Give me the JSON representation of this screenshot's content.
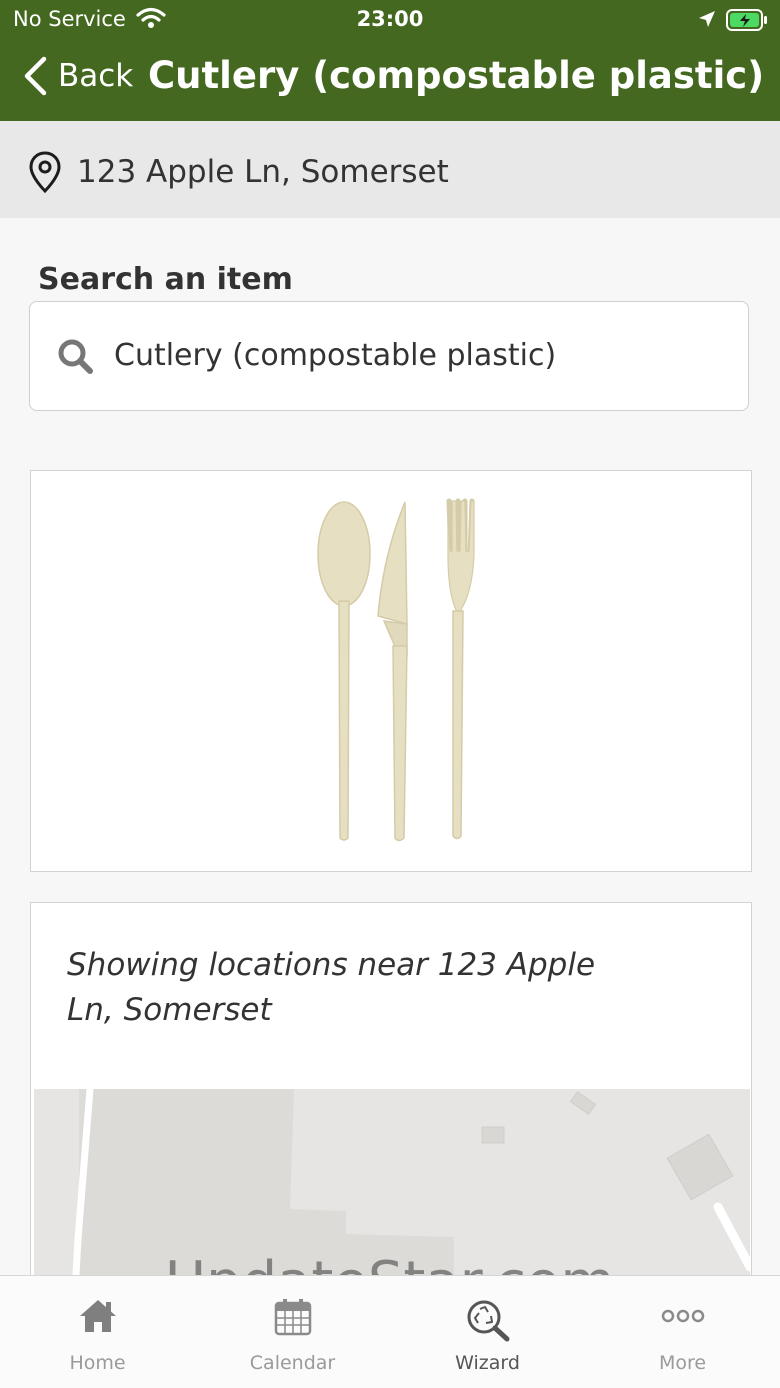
{
  "status_bar": {
    "carrier": "No Service",
    "time": "23:00"
  },
  "nav": {
    "back_label": "Back",
    "title": "Cutlery (compostable plastic)"
  },
  "location": {
    "address": "123 Apple Ln, Somerset"
  },
  "search": {
    "label": "Search an item",
    "value": "Cutlery (compostable plastic)"
  },
  "locations_card": {
    "showing_text": "Showing locations near 123 Apple Ln, Somerset"
  },
  "watermark": "UpdateStar.com",
  "tabs": [
    {
      "label": "Home",
      "icon": "home-icon"
    },
    {
      "label": "Calendar",
      "icon": "calendar-icon"
    },
    {
      "label": "Wizard",
      "icon": "recycle-search-icon",
      "active": true
    },
    {
      "label": "More",
      "icon": "more-icon"
    }
  ],
  "colors": {
    "header_green": "#44681f",
    "battery_green": "#4cd964"
  }
}
